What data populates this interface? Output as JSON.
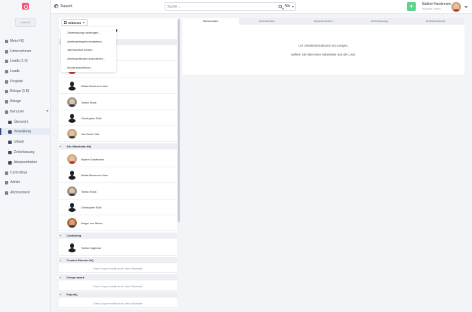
{
  "sidebar": {
    "company_badge": "kallisHQ",
    "items": [
      {
        "label": "Mein HQ",
        "icon": "home-icon"
      },
      {
        "label": "Unternehmen",
        "icon": "building-icon"
      },
      {
        "label": "Leads (1 8)",
        "icon": "tag-icon"
      },
      {
        "label": "Leads",
        "icon": "tag-icon"
      },
      {
        "label": "Projekte",
        "icon": "folder-icon"
      },
      {
        "label": "Belege (1 8)",
        "icon": "receipt-icon"
      },
      {
        "label": "Belege",
        "icon": "receipt-icon"
      },
      {
        "label": "Benutzer",
        "icon": "users-icon"
      },
      {
        "label": "Übersicht",
        "icon": "monitor-icon"
      },
      {
        "label": "Verwaltung",
        "icon": "user-cog-icon"
      },
      {
        "label": "Urlaub",
        "icon": "checkbox-icon"
      },
      {
        "label": "Zeiterfassung",
        "icon": "clock-icon"
      },
      {
        "label": "Abwesenheiten",
        "icon": "monitor-icon"
      },
      {
        "label": "Controlling",
        "icon": "chart-icon"
      },
      {
        "label": "Admin",
        "icon": "wrench-icon"
      },
      {
        "label": "Abonnement",
        "icon": "gear-icon"
      }
    ]
  },
  "topbar": {
    "support_label": "Support",
    "search_placeholder": "Suche ...",
    "search_scope": "Alle",
    "add_label": "+",
    "user_name": "Nadine Karstensen",
    "user_company": "HQLabs GmbH"
  },
  "list": {
    "actions_label": "Aktionen",
    "groups": [
      {
        "label": "Alle Mitarbeiter HQ"
      },
      {
        "label": "Controlling"
      },
      {
        "label": "Creative Director HQ"
      },
      {
        "label": "Design awork"
      },
      {
        "label": "Foto HQ"
      }
    ],
    "top_rows": [
      {
        "name": "Niklas Rentzsch-Holm"
      },
      {
        "name": "Tobias Stock"
      },
      {
        "name": "Christopher Stoll"
      },
      {
        "name": "Jan-David Völz"
      }
    ],
    "alle_rows": [
      {
        "name": "Nadine Karstensen"
      },
      {
        "name": "Niklas Rentzsch-Holm"
      },
      {
        "name": "Tobias Stock"
      },
      {
        "name": "Christopher Stoll"
      },
      {
        "name": "Holger von Below"
      }
    ],
    "controlling_rows": [
      {
        "name": "Tobias Hagenau"
      }
    ],
    "empty_text": "Diese Gruppe enthält derzeit keine Mitarbeiter"
  },
  "dropdown": {
    "items": [
      "Zeiterfassung nachtragen...",
      "Arbeitszeitregeln bearbeiten...",
      "Jahresurlaub setzen...",
      "Arbeitszeitkonten exportieren...",
      "Monat abschließen..."
    ]
  },
  "detail": {
    "tabs": [
      "Stammdaten",
      "Arbeitszeiten",
      "Abwesenheiten",
      "Zeiterfassung",
      "Arbeitszeitkonto"
    ],
    "message_line1": "Um Detailinformationen anzuzeigen,",
    "message_line2": "wählen Sie bitte einen Mitarbeiter aus der Liste."
  },
  "colors": {
    "accent": "#3a4d7a",
    "add_button": "#5dd48a",
    "logo": "#ef5a79"
  }
}
